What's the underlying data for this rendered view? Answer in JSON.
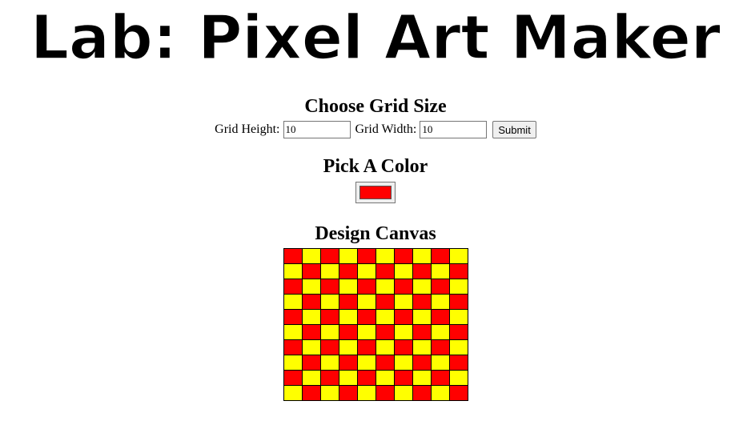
{
  "header": {
    "title": "Lab: Pixel Art Maker"
  },
  "grid_size": {
    "heading": "Choose Grid Size",
    "height_label": "Grid Height:",
    "height_value": "10",
    "width_label": "Grid Width:",
    "width_value": "10",
    "submit_label": "Submit"
  },
  "color": {
    "heading": "Pick A Color",
    "value": "#ff0000"
  },
  "canvas": {
    "heading": "Design Canvas",
    "rows": 10,
    "cols": 10,
    "colors": {
      "red": "#ff0000",
      "yellow": "#ffff00"
    },
    "cells": [
      [
        "red",
        "yellow",
        "red",
        "yellow",
        "red",
        "yellow",
        "red",
        "yellow",
        "red",
        "yellow"
      ],
      [
        "yellow",
        "red",
        "yellow",
        "red",
        "yellow",
        "red",
        "yellow",
        "red",
        "yellow",
        "red"
      ],
      [
        "red",
        "yellow",
        "red",
        "yellow",
        "red",
        "yellow",
        "red",
        "yellow",
        "red",
        "yellow"
      ],
      [
        "yellow",
        "red",
        "yellow",
        "red",
        "yellow",
        "red",
        "yellow",
        "red",
        "yellow",
        "red"
      ],
      [
        "red",
        "yellow",
        "red",
        "yellow",
        "red",
        "yellow",
        "red",
        "yellow",
        "red",
        "yellow"
      ],
      [
        "yellow",
        "red",
        "yellow",
        "red",
        "yellow",
        "red",
        "yellow",
        "red",
        "yellow",
        "red"
      ],
      [
        "red",
        "yellow",
        "red",
        "yellow",
        "red",
        "yellow",
        "red",
        "yellow",
        "red",
        "yellow"
      ],
      [
        "yellow",
        "red",
        "yellow",
        "red",
        "yellow",
        "red",
        "yellow",
        "red",
        "yellow",
        "red"
      ],
      [
        "red",
        "yellow",
        "red",
        "yellow",
        "red",
        "yellow",
        "red",
        "yellow",
        "red",
        "yellow"
      ],
      [
        "yellow",
        "red",
        "yellow",
        "red",
        "yellow",
        "red",
        "yellow",
        "red",
        "yellow",
        "red"
      ]
    ]
  }
}
